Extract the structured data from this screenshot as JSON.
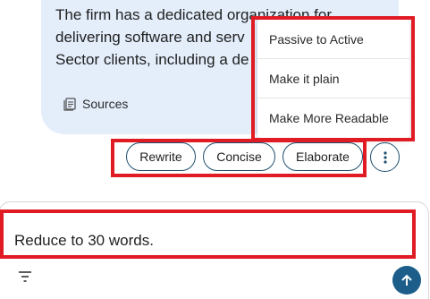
{
  "message": {
    "lines": [
      "The firm has a dedicated organization for",
      "delivering software and serv",
      "Sector clients, including a de"
    ],
    "sources_label": "Sources"
  },
  "actions": {
    "chips": [
      "Rewrite",
      "Concise",
      "Elaborate"
    ],
    "more_icon": "more-vertical-icon"
  },
  "menu": {
    "items": [
      "Passive to Active",
      "Make it plain",
      "Make More Readable"
    ]
  },
  "input": {
    "value": "Reduce to 30 words.",
    "filter_icon": "filter-icon",
    "send_icon": "arrow-up-icon"
  },
  "colors": {
    "bubble_bg": "#e4eefb",
    "accent": "#1c5d8a",
    "chip_border": "#1f4f6e",
    "highlight": "#e01b24"
  }
}
